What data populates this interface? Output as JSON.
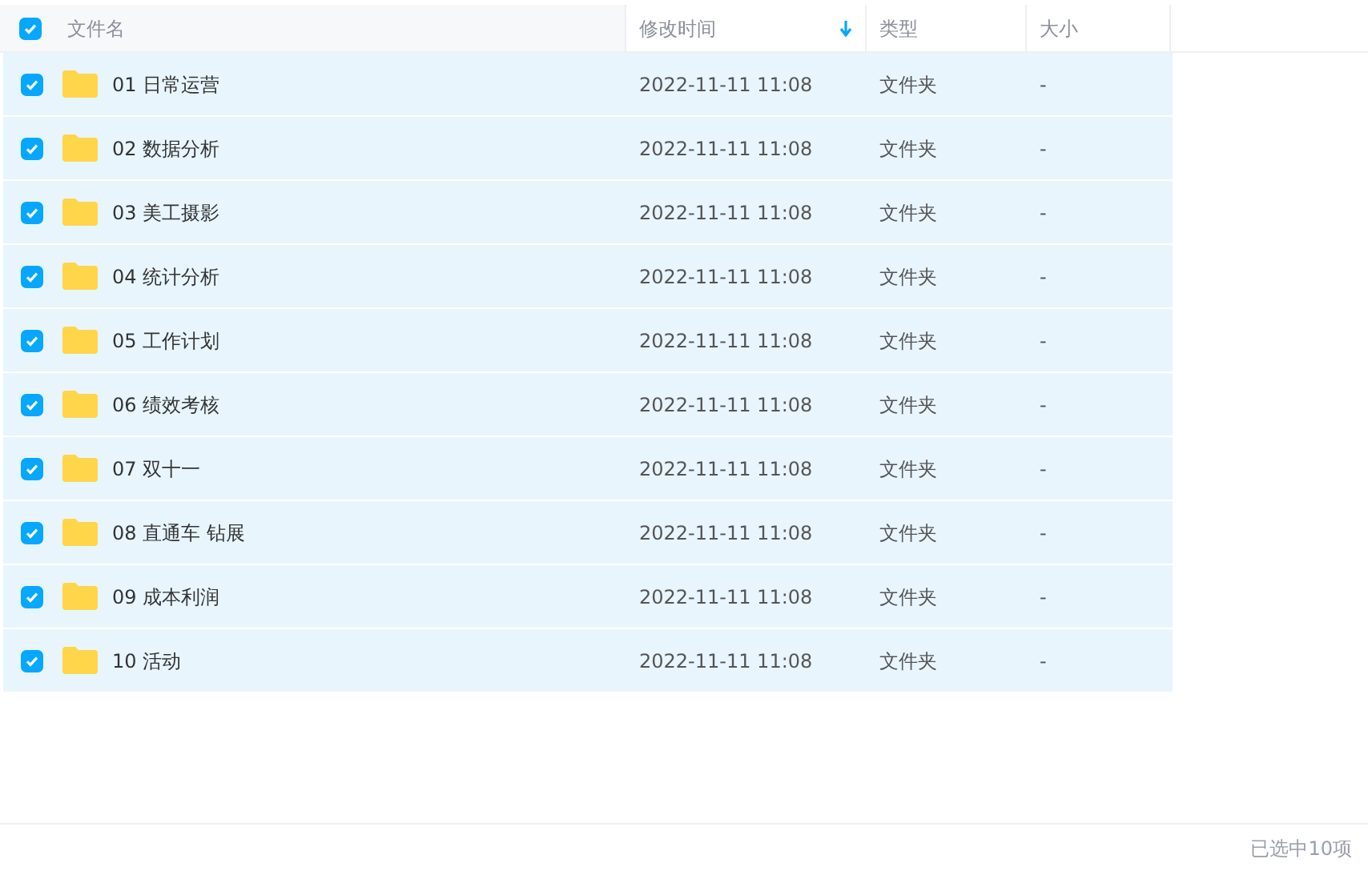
{
  "select_all": {
    "checked": true
  },
  "columns": [
    {
      "label": "文件名",
      "sorted": false
    },
    {
      "label": "修改时间",
      "sorted": true
    },
    {
      "label": "类型",
      "sorted": false
    },
    {
      "label": "大小",
      "sorted": false
    }
  ],
  "rows": [
    {
      "name": "01 日常运营",
      "modified": "2022-11-11 11:08",
      "type": "文件夹",
      "size": "-",
      "selected": true
    },
    {
      "name": "02 数据分析",
      "modified": "2022-11-11 11:08",
      "type": "文件夹",
      "size": "-",
      "selected": true
    },
    {
      "name": "03 美工摄影",
      "modified": "2022-11-11 11:08",
      "type": "文件夹",
      "size": "-",
      "selected": true
    },
    {
      "name": "04 统计分析",
      "modified": "2022-11-11 11:08",
      "type": "文件夹",
      "size": "-",
      "selected": true
    },
    {
      "name": "05 工作计划",
      "modified": "2022-11-11 11:08",
      "type": "文件夹",
      "size": "-",
      "selected": true
    },
    {
      "name": "06 绩效考核",
      "modified": "2022-11-11 11:08",
      "type": "文件夹",
      "size": "-",
      "selected": true
    },
    {
      "name": "07 双十一",
      "modified": "2022-11-11 11:08",
      "type": "文件夹",
      "size": "-",
      "selected": true
    },
    {
      "name": "08 直通车 钻展",
      "modified": "2022-11-11 11:08",
      "type": "文件夹",
      "size": "-",
      "selected": true
    },
    {
      "name": "09 成本利润",
      "modified": "2022-11-11 11:08",
      "type": "文件夹",
      "size": "-",
      "selected": true
    },
    {
      "name": "10 活动",
      "modified": "2022-11-11 11:08",
      "type": "文件夹",
      "size": "-",
      "selected": true
    }
  ],
  "status_bar": "已选中10项"
}
